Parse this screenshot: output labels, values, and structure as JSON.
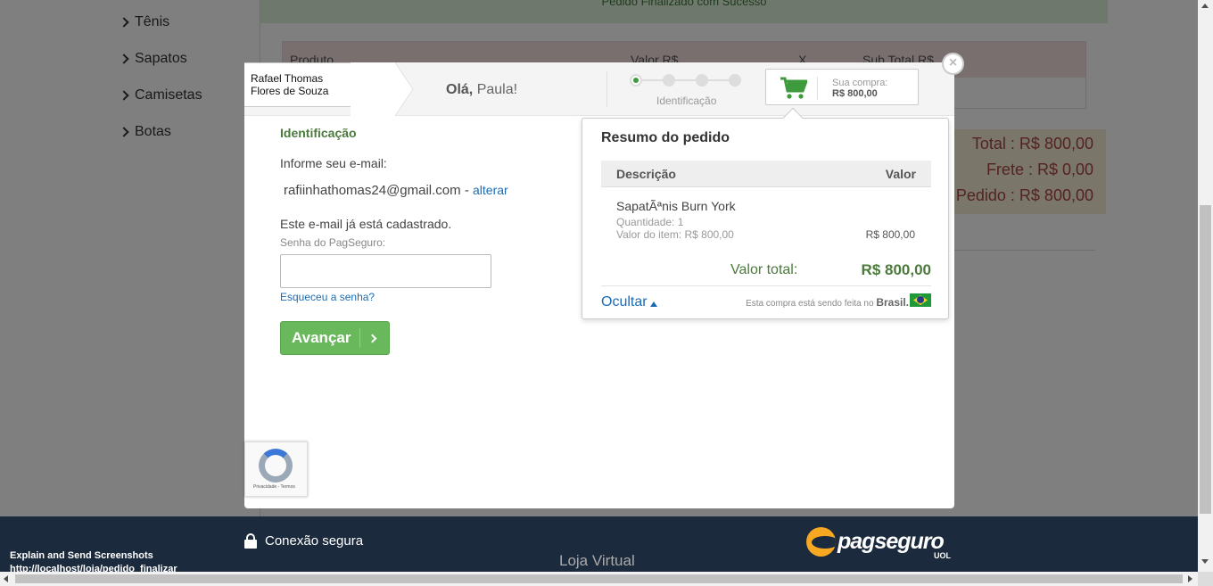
{
  "store": {
    "categories": [
      "Tênis",
      "Sapatos",
      "Camisetas",
      "Botas"
    ],
    "banner": "Pedido Finalizado com Sucesso",
    "table_headers": [
      "Produto",
      "Valor R$",
      "X",
      "Sub Total R$"
    ],
    "totals": [
      "Total : R$ 800,00",
      "Frete : R$ 0,00",
      "Pedido : R$ 800,00"
    ]
  },
  "modal": {
    "merchant_name": "Rafael Thomas Flores de Souza",
    "greeting_prefix": "Olá,",
    "greeting_name": "Paula!",
    "steps": {
      "count": 4,
      "active": 1,
      "current_label": "Identificação"
    },
    "cart": {
      "label": "Sua compra:",
      "value": "R$ 800,00"
    },
    "close_symbol": "×",
    "form": {
      "section_title": "Identificação",
      "email_label": "Informe seu e-mail:",
      "email_value": "rafiinhathomas24@gmail.com",
      "email_separator": "-",
      "change_link": "alterar",
      "registered_note": "Este e-mail já está cadastrado.",
      "password_label": "Senha do PagSeguro:",
      "password_value": "",
      "forgot_link": "Esqueceu a senha?",
      "submit_label": "Avançar"
    },
    "summary": {
      "title": "Resumo do pedido",
      "col_description": "Descrição",
      "col_value": "Valor",
      "item": {
        "name": "SapatÃªnis Burn York",
        "quantity": "Quantidade: 1",
        "unit_value": "Valor do item: R$ 800,00",
        "price": "R$ 800,00"
      },
      "total_label": "Valor total:",
      "total_value": "R$ 800,00",
      "hide_label": "Ocultar",
      "country_note": "Esta compra está sendo feita no",
      "country": "Brasil."
    },
    "recaptcha_text": "Privacidade - Termos"
  },
  "footer": {
    "secure_label": "Conexão segura",
    "store_label": "Loja Virtual",
    "brand": "pagseguro",
    "brand_sub": "UOL",
    "extension_title": "Explain and Send Screenshots",
    "url": "http://localhost/loja/pedido_finalizar"
  },
  "colors": {
    "accent_green": "#4b7a3c",
    "button_green": "#6ab85c",
    "link_blue": "#1b6bb4",
    "footer_navy": "#1b2a3d",
    "brand_orange": "#f7a823"
  }
}
